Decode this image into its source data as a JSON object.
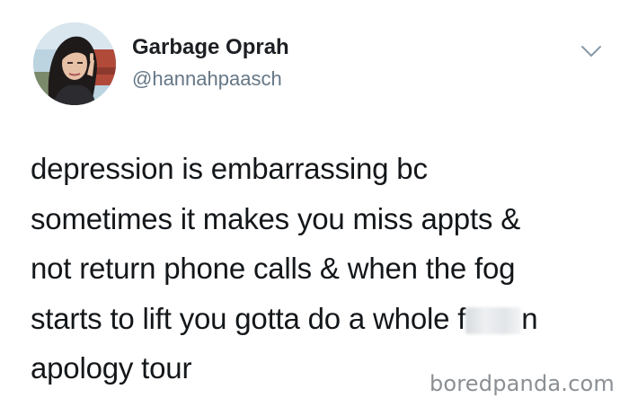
{
  "author": {
    "display_name": "Garbage Oprah",
    "handle": "@hannahpaasch",
    "avatar_icon": "profile-photo"
  },
  "menu": {
    "icon": "chevron-down-icon"
  },
  "tweet": {
    "lines": [
      "depression is embarrassing bc",
      "sometimes it makes you miss appts &",
      "not return phone calls & when the fog",
      "starts to lift you gotta do a whole f",
      "apology tour"
    ],
    "line4_suffix": "n"
  },
  "watermark": "boredpanda.com",
  "colors": {
    "text": "#14171a",
    "secondary": "#657786",
    "watermark": "#8a8f93"
  }
}
